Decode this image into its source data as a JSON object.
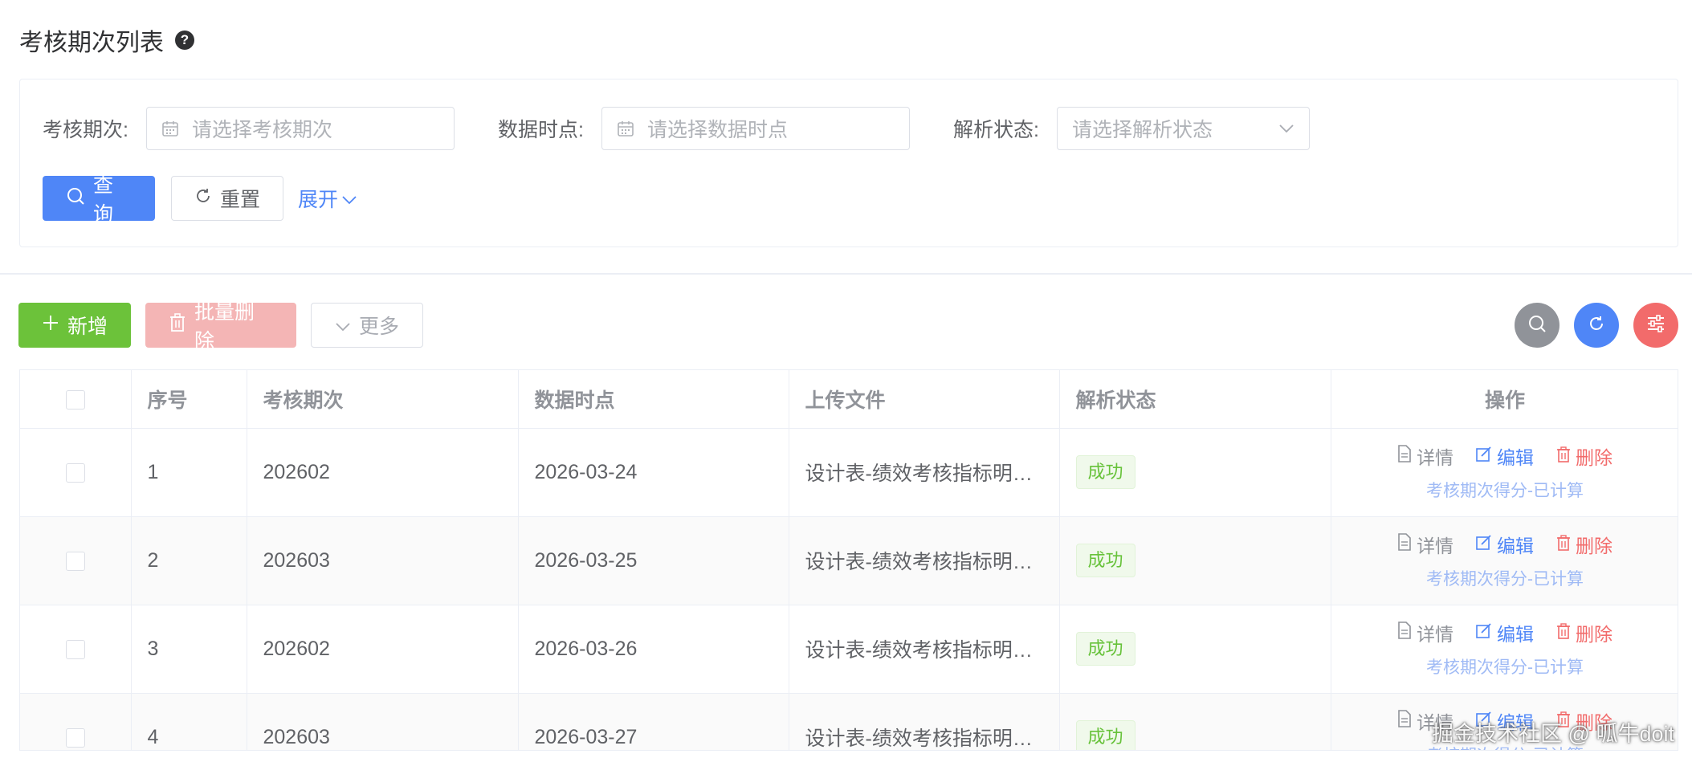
{
  "page": {
    "title": "考核期次列表",
    "help_icon": "question-circle-icon"
  },
  "search": {
    "fields": [
      {
        "label": "考核期次:",
        "placeholder": "请选择考核期次",
        "icon": "calendar-icon"
      },
      {
        "label": "数据时点:",
        "placeholder": "请选择数据时点",
        "icon": "calendar-icon"
      },
      {
        "label": "解析状态:",
        "placeholder": "请选择解析状态",
        "icon": "chevron-down-icon"
      }
    ],
    "query_label": "查询",
    "reset_label": "重置",
    "expand_label": "展开"
  },
  "toolbar": {
    "add_label": "新增",
    "batch_delete_label": "批量删除",
    "more_label": "更多"
  },
  "table": {
    "columns": [
      "序号",
      "考核期次",
      "数据时点",
      "上传文件",
      "解析状态",
      "操作"
    ],
    "rows": [
      {
        "no": "1",
        "period": "202602",
        "date": "2026-03-24",
        "file": "设计表-绩效考核指标明…",
        "status": "成功"
      },
      {
        "no": "2",
        "period": "202603",
        "date": "2026-03-25",
        "file": "设计表-绩效考核指标明…",
        "status": "成功"
      },
      {
        "no": "3",
        "period": "202602",
        "date": "2026-03-26",
        "file": "设计表-绩效考核指标明…",
        "status": "成功"
      },
      {
        "no": "4",
        "period": "202603",
        "date": "2026-03-27",
        "file": "设计表-绩效考核指标明…",
        "status": "成功"
      }
    ],
    "ops": {
      "detail": "详情",
      "edit": "编辑",
      "delete": "删除",
      "sub": "考核期次得分-已计算"
    }
  },
  "colors": {
    "primary": "#4f86f7",
    "success": "#6cc23a",
    "danger": "#f26b6b"
  },
  "watermark": "掘金技术社区 @ 呱牛doit"
}
